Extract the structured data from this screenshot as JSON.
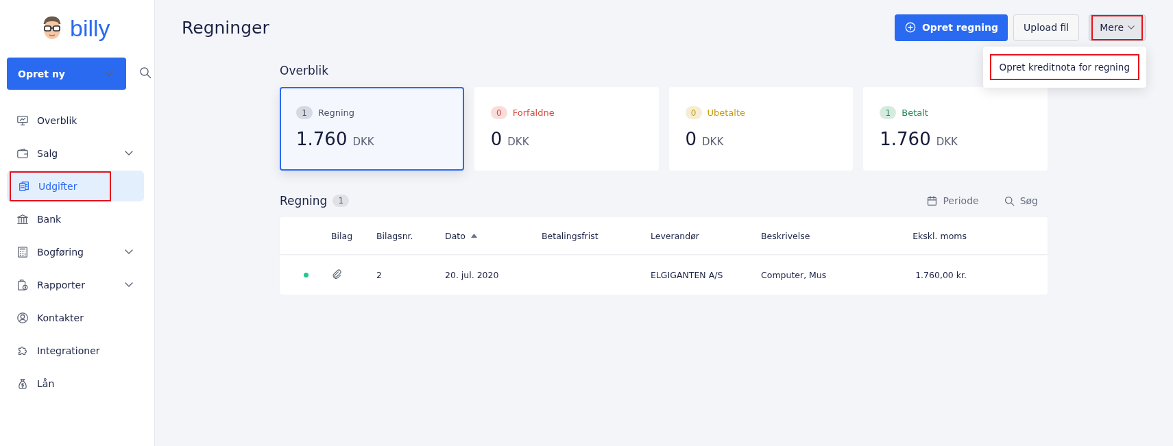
{
  "sidebar": {
    "logo": "billy",
    "create_button": "Opret ny",
    "items": [
      {
        "label": "Overblik",
        "expandable": false,
        "selected": false,
        "annotated": false
      },
      {
        "label": "Salg",
        "expandable": true,
        "selected": false,
        "annotated": false
      },
      {
        "label": "Udgifter",
        "expandable": false,
        "selected": true,
        "annotated": true
      },
      {
        "label": "Bank",
        "expandable": false,
        "selected": false,
        "annotated": false
      },
      {
        "label": "Bogføring",
        "expandable": true,
        "selected": false,
        "annotated": false
      },
      {
        "label": "Rapporter",
        "expandable": true,
        "selected": false,
        "annotated": false
      },
      {
        "label": "Kontakter",
        "expandable": false,
        "selected": false,
        "annotated": false
      },
      {
        "label": "Integrationer",
        "expandable": false,
        "selected": false,
        "annotated": false
      },
      {
        "label": "Lån",
        "expandable": false,
        "selected": false,
        "annotated": false
      }
    ]
  },
  "header": {
    "title": "Regninger",
    "primary_button": "Opret regning",
    "upload_button": "Upload fil",
    "more_button": {
      "label": "Mere",
      "annotated": true
    },
    "menu": [
      {
        "label": "Opret kreditnota for regning",
        "annotated": true
      }
    ]
  },
  "overview": {
    "title": "Overblik",
    "cards": [
      {
        "count": "1",
        "label": "Regning",
        "amount": "1.760",
        "currency": "DKK",
        "color": "#4a5165",
        "selected": true
      },
      {
        "count": "0",
        "label": "Forfaldne",
        "amount": "0",
        "currency": "DKK",
        "color": "#d44a3f",
        "selected": false
      },
      {
        "count": "0",
        "label": "Ubetalte",
        "amount": "0",
        "currency": "DKK",
        "color": "#c79b10",
        "selected": false
      },
      {
        "count": "1",
        "label": "Betalt",
        "amount": "1.760",
        "currency": "DKK",
        "color": "#1f8a55",
        "selected": false
      }
    ]
  },
  "table": {
    "title": "Regning",
    "count": "1",
    "period_button": "Periode",
    "search_button": "Søg",
    "columns": [
      {
        "label": "Bilag"
      },
      {
        "label": "Bilagsnr."
      },
      {
        "label": "Dato",
        "sorted": true
      },
      {
        "label": "Betalingsfrist"
      },
      {
        "label": "Leverandør"
      },
      {
        "label": "Beskrivelse"
      },
      {
        "label": "Ekskl. moms"
      }
    ],
    "rows": [
      {
        "color": "#1ec98b",
        "attachment": true,
        "cells": [
          "",
          "2",
          "20. jul. 2020",
          "",
          "ELGIGANTEN A/S",
          "Computer, Mus",
          "1.760,00 kr."
        ]
      }
    ]
  }
}
